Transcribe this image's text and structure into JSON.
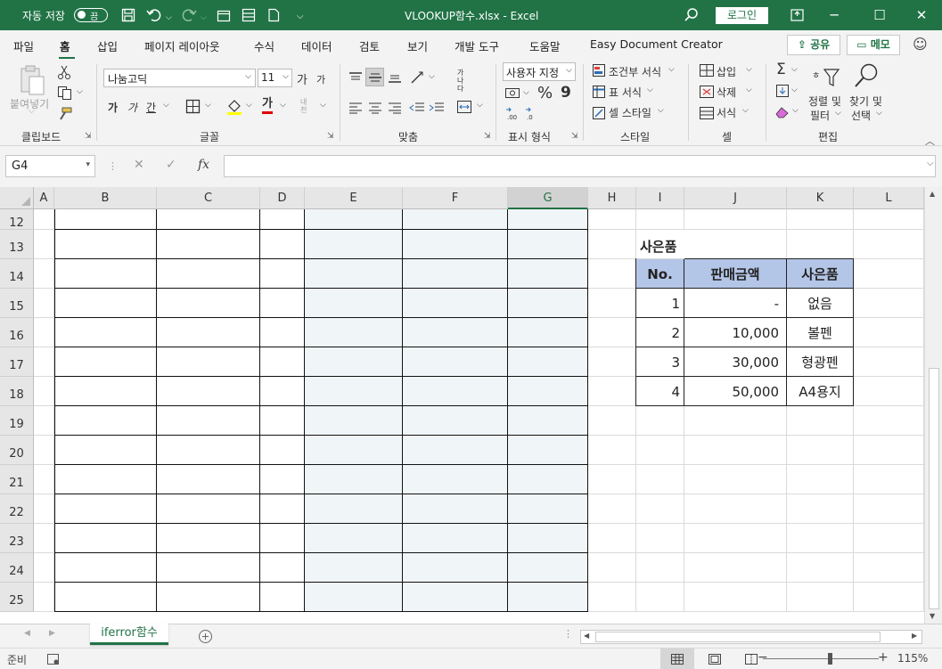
{
  "titlebar": {
    "autosave_label": "자동 저장",
    "autosave_state": "끔",
    "doc_title": "VLOOKUP함수.xlsx  -  Excel",
    "login_label": "로그인",
    "icons": [
      "save-icon",
      "undo-icon",
      "redo-icon",
      "customize-icon",
      "search-icon",
      "ribbon-display-icon",
      "minimize-icon",
      "maximize-icon",
      "close-icon"
    ]
  },
  "tabs": [
    {
      "label": "파일",
      "active": false
    },
    {
      "label": "홈",
      "active": true
    },
    {
      "label": "삽입",
      "active": false
    },
    {
      "label": "페이지 레이아웃",
      "active": false
    },
    {
      "label": "수식",
      "active": false
    },
    {
      "label": "데이터",
      "active": false
    },
    {
      "label": "검토",
      "active": false
    },
    {
      "label": "보기",
      "active": false
    },
    {
      "label": "개발 도구",
      "active": false
    },
    {
      "label": "도움말",
      "active": false
    },
    {
      "label": "Easy Document Creator",
      "active": false
    }
  ],
  "share_label": "공유",
  "memo_label": "메모",
  "ribbon": {
    "clipboard": {
      "label": "클립보드",
      "paste": "붙여넣기"
    },
    "font": {
      "label": "글꼴",
      "font_name": "나눔고딕",
      "font_size": "11",
      "bold": "가",
      "italic": "가",
      "underline": "간",
      "grow": "가",
      "shrink": "가",
      "phonetic": "내천"
    },
    "alignment": {
      "label": "맞춤",
      "wrap": "가나다"
    },
    "number": {
      "label": "표시 형식",
      "format": "사용자 지정",
      "percent": "%",
      "comma": "9"
    },
    "styles": {
      "label": "스타일",
      "conditional": "조건부 서식",
      "table": "표 서식",
      "cell_styles": "셀 스타일"
    },
    "cells": {
      "label": "셀",
      "insert": "삽입",
      "delete": "삭제",
      "format": "서식"
    },
    "editing": {
      "label": "편집",
      "sort_filter_1": "정렬 및",
      "sort_filter_2": "필터",
      "find_select_1": "찾기 및",
      "find_select_2": "선택"
    }
  },
  "formula_bar": {
    "name_box": "G4",
    "formula": "",
    "fx": "fx"
  },
  "columns": [
    "A",
    "B",
    "C",
    "D",
    "E",
    "F",
    "G",
    "H",
    "I",
    "J",
    "K",
    "L"
  ],
  "selected_column": "G",
  "rows": [
    "12",
    "13",
    "14",
    "15",
    "16",
    "17",
    "18",
    "19",
    "20",
    "21",
    "22",
    "23",
    "24",
    "25"
  ],
  "gift_table": {
    "title": "사은품",
    "headers": [
      "No.",
      "판매금액",
      "사은품"
    ],
    "rows": [
      [
        "1",
        "-",
        "없음"
      ],
      [
        "2",
        "10,000",
        "볼펜"
      ],
      [
        "3",
        "30,000",
        "형광펜"
      ],
      [
        "4",
        "50,000",
        "A4용지"
      ]
    ],
    "header_color": "#b4c6e7"
  },
  "sheet_tabs": [
    {
      "label": "iferror함수",
      "active": true
    }
  ],
  "status": {
    "ready": "준비",
    "zoom": "115%"
  },
  "colors": {
    "excel_green": "#217346",
    "shaded_col": "#f0f6f8"
  }
}
